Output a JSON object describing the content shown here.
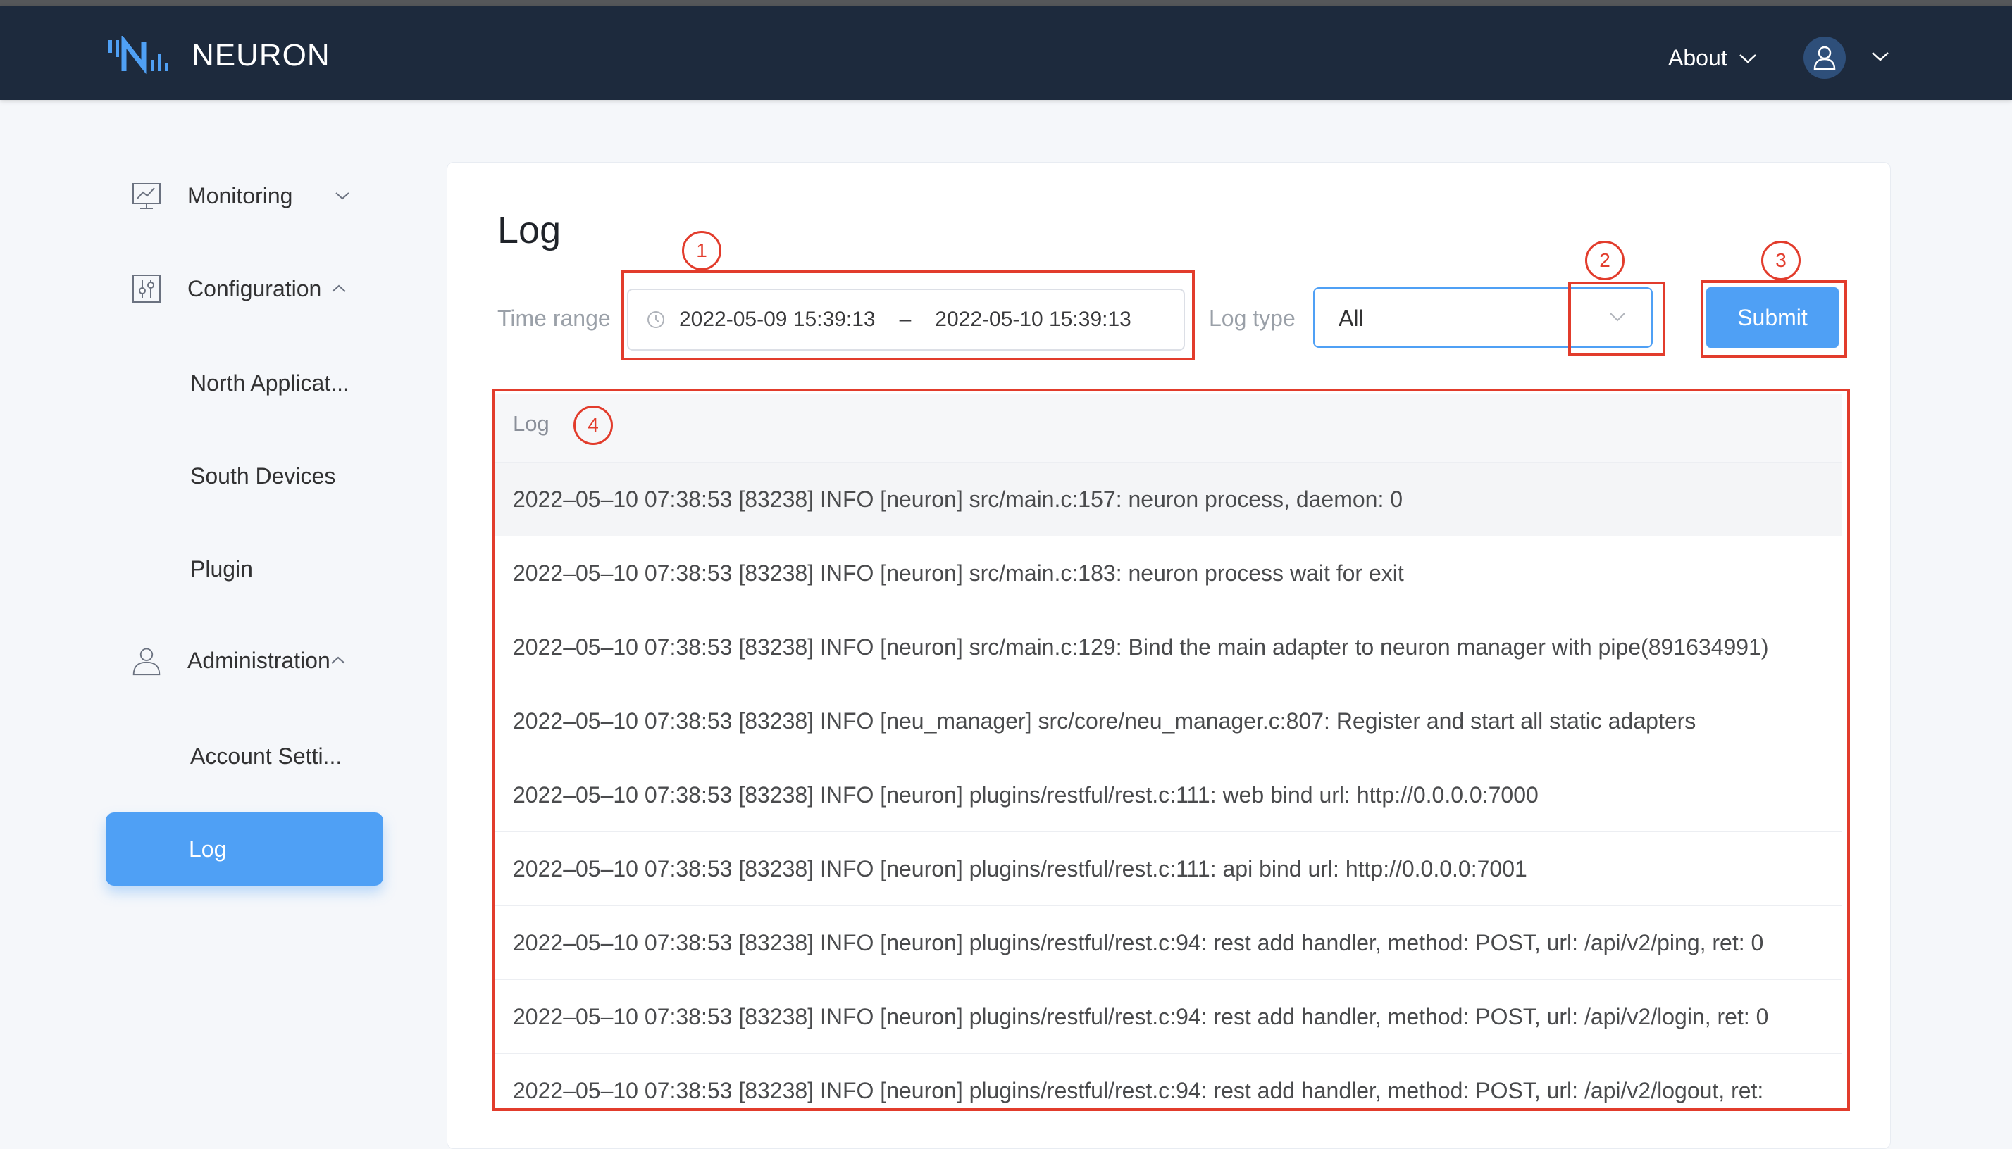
{
  "app": {
    "name": "NEURON"
  },
  "header": {
    "about_label": "About"
  },
  "sidebar": {
    "monitoring": "Monitoring",
    "configuration": "Configuration",
    "config_items": [
      "North Applicat...",
      "South Devices",
      "Plugin"
    ],
    "administration": "Administration",
    "admin_items": [
      "Account Setti...",
      "Log"
    ]
  },
  "page": {
    "title": "Log"
  },
  "filters": {
    "time_range_label": "Time range",
    "start": "2022-05-09 15:39:13",
    "separator": "–",
    "end": "2022-05-10 15:39:13",
    "log_type_label": "Log type",
    "log_type_value": "All",
    "submit_label": "Submit"
  },
  "log_table": {
    "header": "Log",
    "rows": [
      "2022–05–10 07:38:53 [83238] INFO [neuron] src/main.c:157: neuron process, daemon: 0",
      "2022–05–10 07:38:53 [83238] INFO [neuron] src/main.c:183: neuron process wait for exit",
      "2022–05–10 07:38:53 [83238] INFO [neuron] src/main.c:129: Bind the main adapter to neuron manager with pipe(891634991)",
      "2022–05–10 07:38:53 [83238] INFO [neu_manager] src/core/neu_manager.c:807: Register and start all static adapters",
      "2022–05–10 07:38:53 [83238] INFO [neuron] plugins/restful/rest.c:111: web bind url: http://0.0.0.0:7000",
      "2022–05–10 07:38:53 [83238] INFO [neuron] plugins/restful/rest.c:111: api bind url: http://0.0.0.0:7001",
      "2022–05–10 07:38:53 [83238] INFO [neuron] plugins/restful/rest.c:94: rest add handler, method: POST, url: /api/v2/ping, ret: 0",
      "2022–05–10 07:38:53 [83238] INFO [neuron] plugins/restful/rest.c:94: rest add handler, method: POST, url: /api/v2/login, ret: 0",
      "2022–05–10 07:38:53 [83238] INFO [neuron] plugins/restful/rest.c:94: rest add handler, method: POST, url: /api/v2/logout, ret:"
    ]
  },
  "annotations": [
    "1",
    "2",
    "3",
    "4"
  ],
  "colors": {
    "header_bg": "#1d2a3d",
    "accent": "#4fa0f5",
    "annotation": "#e23c2c"
  },
  "icons": [
    "neuron-logo-icon",
    "chevron-down-icon",
    "user-icon",
    "monitor-icon",
    "sliders-icon",
    "chevron-up-icon",
    "clock-icon"
  ]
}
